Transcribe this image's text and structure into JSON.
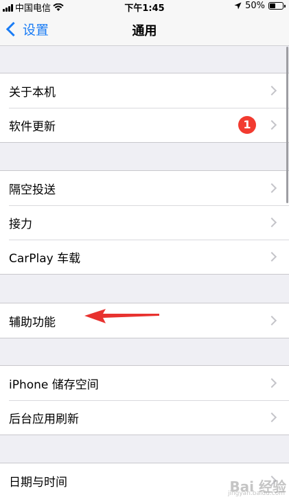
{
  "status_bar": {
    "carrier": "中国电信",
    "time": "下午1:45",
    "battery": "50%",
    "battery_level": 0.5,
    "signal_icon": "cellular-signal-icon",
    "wifi_icon": "wifi-icon",
    "location_icon": "location-arrow-icon"
  },
  "nav": {
    "back_label": "设置",
    "title": "通用"
  },
  "groups": [
    {
      "items": [
        {
          "label": "关于本机"
        },
        {
          "label": "软件更新",
          "badge": "1"
        }
      ]
    },
    {
      "items": [
        {
          "label": "隔空投送"
        },
        {
          "label": "接力"
        },
        {
          "label": "CarPlay 车载"
        }
      ]
    },
    {
      "items": [
        {
          "label": "辅助功能"
        }
      ]
    },
    {
      "items": [
        {
          "label": "iPhone 储存空间"
        },
        {
          "label": "后台应用刷新"
        }
      ]
    },
    {
      "items": [
        {
          "label": "日期与时间"
        }
      ]
    }
  ],
  "watermark": "Bai 经验",
  "watermark_url": "jingyan.baidu.com",
  "colors": {
    "accent": "#1a7cf5",
    "badge": "#f23b30",
    "annotation_arrow": "#e8322f",
    "background": "#efeff4"
  }
}
